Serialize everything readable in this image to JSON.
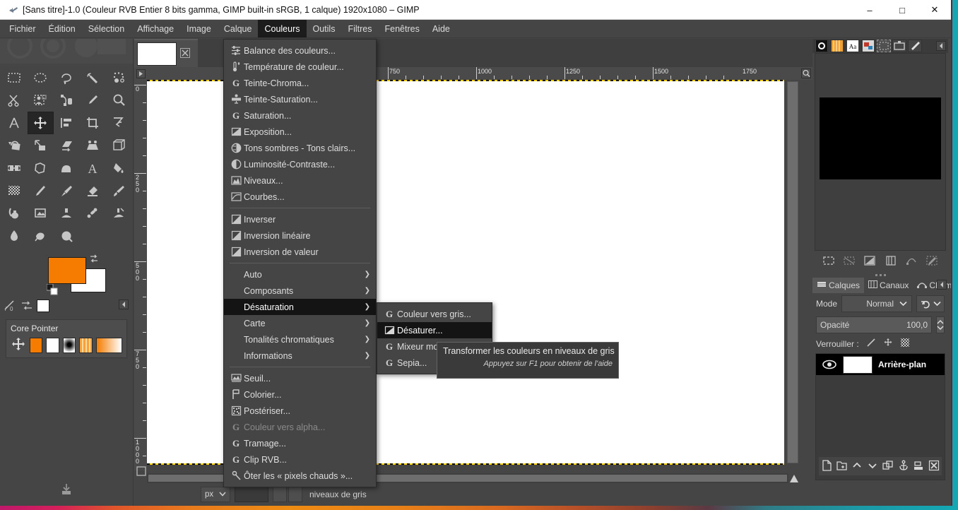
{
  "window": {
    "title": "[Sans titre]-1.0 (Couleur RVB Entier 8 bits gamma, GIMP built-in sRGB, 1 calque) 1920x1080 – GIMP",
    "app_icon": "gimp-wilber-icon",
    "controls": {
      "minimize": "–",
      "maximize": "□",
      "close": "✕"
    }
  },
  "menubar": {
    "items": [
      {
        "label": "Fichier"
      },
      {
        "label": "Édition"
      },
      {
        "label": "Sélection"
      },
      {
        "label": "Affichage"
      },
      {
        "label": "Image"
      },
      {
        "label": "Calque"
      },
      {
        "label": "Couleurs"
      },
      {
        "label": "Outils"
      },
      {
        "label": "Filtres"
      },
      {
        "label": "Fenêtres"
      },
      {
        "label": "Aide"
      }
    ],
    "active": "Couleurs"
  },
  "colors_menu": {
    "groups": [
      {
        "items": [
          {
            "label": "Balance des couleurs...",
            "icon": "color-balance-icon",
            "type": "item"
          },
          {
            "label": "Température de couleur...",
            "icon": "thermometer-icon",
            "type": "item"
          },
          {
            "label": "Teinte-Chroma...",
            "icon": "gegl-g-icon",
            "type": "item"
          },
          {
            "label": "Teinte-Saturation...",
            "icon": "hue-saturation-icon",
            "type": "item"
          },
          {
            "label": "Saturation...",
            "icon": "gegl-g-icon",
            "type": "item"
          },
          {
            "label": "Exposition...",
            "icon": "exposure-icon",
            "type": "item"
          },
          {
            "label": "Tons sombres - Tons clairs...",
            "icon": "shadows-highlights-icon",
            "type": "item"
          },
          {
            "label": "Luminosité-Contraste...",
            "icon": "brightness-contrast-icon",
            "type": "item"
          },
          {
            "label": "Niveaux...",
            "icon": "levels-icon",
            "type": "item"
          },
          {
            "label": "Courbes...",
            "icon": "curves-icon",
            "type": "item"
          }
        ]
      },
      {
        "items": [
          {
            "label": "Inverser",
            "icon": "invert-icon",
            "type": "item"
          },
          {
            "label": "Inversion linéaire",
            "icon": "invert-icon",
            "type": "item"
          },
          {
            "label": "Inversion de valeur",
            "icon": "invert-icon",
            "type": "item"
          }
        ]
      },
      {
        "items": [
          {
            "label": "Auto",
            "icon": "",
            "type": "submenu"
          },
          {
            "label": "Composants",
            "icon": "",
            "type": "submenu"
          },
          {
            "label": "Désaturation",
            "icon": "",
            "type": "submenu",
            "highlighted": true
          },
          {
            "label": "Carte",
            "icon": "",
            "type": "submenu"
          },
          {
            "label": "Tonalités chromatiques",
            "icon": "",
            "type": "submenu"
          },
          {
            "label": "Informations",
            "icon": "",
            "type": "submenu"
          }
        ]
      },
      {
        "items": [
          {
            "label": "Seuil...",
            "icon": "threshold-icon",
            "type": "item"
          },
          {
            "label": "Colorier...",
            "icon": "colorize-icon",
            "type": "item"
          },
          {
            "label": "Postériser...",
            "icon": "posterize-icon",
            "type": "item"
          },
          {
            "label": "Couleur vers alpha...",
            "icon": "gegl-g-icon",
            "type": "item",
            "disabled": true
          },
          {
            "label": "Tramage...",
            "icon": "gegl-g-icon",
            "type": "item"
          },
          {
            "label": "Clip RVB...",
            "icon": "gegl-g-icon",
            "type": "item"
          },
          {
            "label": "Ôter les « pixels chauds »...",
            "icon": "hot-pixels-icon",
            "type": "item"
          }
        ]
      }
    ]
  },
  "desaturation_submenu": {
    "items": [
      {
        "label": "Couleur vers gris...",
        "icon": "gegl-g-icon"
      },
      {
        "label": "Désaturer...",
        "icon": "desaturate-icon",
        "highlighted": true
      },
      {
        "label": "Mixeur monochrome...",
        "icon": "gegl-g-icon"
      },
      {
        "label": "Sepia...",
        "icon": "gegl-g-icon"
      }
    ]
  },
  "tooltip": {
    "text": "Transformer les couleurs en niveaux de gris",
    "hint": "Appuyez sur F1 pour obtenir de l'aide"
  },
  "toolbox": {
    "tools": [
      {
        "name": "rect-select-tool"
      },
      {
        "name": "ellipse-select-tool"
      },
      {
        "name": "free-select-tool"
      },
      {
        "name": "fuzzy-select-tool"
      },
      {
        "name": "select-by-color-tool"
      },
      {
        "name": "scissors-select-tool"
      },
      {
        "name": "foreground-select-tool"
      },
      {
        "name": "paths-tool"
      },
      {
        "name": "color-picker-tool"
      },
      {
        "name": "zoom-tool"
      },
      {
        "name": "measure-tool"
      },
      {
        "name": "move-tool"
      },
      {
        "name": "alignment-tool"
      },
      {
        "name": "crop-tool"
      },
      {
        "name": "transform-tool"
      },
      {
        "name": "rotate-tool"
      },
      {
        "name": "scale-tool"
      },
      {
        "name": "shear-tool"
      },
      {
        "name": "perspective-tool"
      },
      {
        "name": "3d-transform-tool"
      },
      {
        "name": "flip-tool"
      },
      {
        "name": "cage-transform-tool"
      },
      {
        "name": "warp-transform-tool"
      },
      {
        "name": "text-tool"
      },
      {
        "name": "bucket-fill-tool"
      },
      {
        "name": "gradient-tool"
      },
      {
        "name": "pencil-tool"
      },
      {
        "name": "paintbrush-tool"
      },
      {
        "name": "eraser-tool"
      },
      {
        "name": "ink-tool"
      },
      {
        "name": "mypaint-brush-tool"
      },
      {
        "name": "clone-tool"
      },
      {
        "name": "heal-tool"
      },
      {
        "name": "perspective-clone-tool"
      },
      {
        "name": "blur-sharpen-tool"
      },
      {
        "name": "smudge-tool"
      },
      {
        "name": "dodge-burn-tool"
      }
    ],
    "selected_tool": "move-tool",
    "foreground_color": "#f57c00",
    "background_color": "#ffffff",
    "device_status": {
      "title": "Core Pointer",
      "device_icon": "move-tool",
      "fg_swatch": "#f57c00",
      "bg_swatch": "#ffffff",
      "brush": "brush-hardness-050",
      "pattern": "pattern-stripes",
      "gradient": "gradient-fg-to-bg"
    }
  },
  "image_window": {
    "tab_thumbnail": "image-thumbnail",
    "close_tab_icon": "close-icon",
    "rulers": {
      "horizontal_labels": [
        "750",
        "1000",
        "1250",
        "1500",
        "1750"
      ],
      "vertical_labels": [
        "0",
        "250",
        "500",
        "750",
        "1000"
      ],
      "unit": "px"
    },
    "statusbar": {
      "unit": "px",
      "message": "niveaux de gris",
      "quickmask_icon": "quickmask-icon",
      "navigate_icon": "navigate-icon"
    }
  },
  "right_dock": {
    "upper_tabs": [
      {
        "name": "brushes-tab"
      },
      {
        "name": "patterns-tab"
      },
      {
        "name": "fonts-tab"
      },
      {
        "name": "document-history-tab"
      },
      {
        "name": "selection-editor-tab"
      },
      {
        "name": "undo-history-tab"
      },
      {
        "name": "pointer-tab"
      }
    ],
    "upper_selected": "selection-editor-tab",
    "selection_buttons": [
      {
        "name": "select-all-button"
      },
      {
        "name": "select-none-button"
      },
      {
        "name": "invert-selection-button"
      },
      {
        "name": "save-to-channel-button"
      },
      {
        "name": "to-path-button"
      },
      {
        "name": "stroke-selection-button"
      }
    ],
    "layers_tabs": [
      {
        "label": "Calques",
        "icon": "layers-icon",
        "selected": true
      },
      {
        "label": "Canaux",
        "icon": "channels-icon",
        "selected": false
      },
      {
        "label": "Chemins",
        "icon": "paths-icon",
        "selected": false
      }
    ],
    "mode": {
      "label": "Mode",
      "value": "Normal",
      "reset_icon": "reset-icon"
    },
    "opacity": {
      "label": "Opacité",
      "value": "100,0"
    },
    "lock": {
      "label": "Verrouiller :",
      "items": [
        {
          "name": "lock-pixels-icon"
        },
        {
          "name": "lock-position-icon"
        },
        {
          "name": "lock-alpha-icon"
        }
      ]
    },
    "layers": [
      {
        "name": "Arrière-plan",
        "visible": true,
        "thumbnail_color": "#ffffff"
      }
    ],
    "layer_buttons": [
      {
        "name": "new-layer-button"
      },
      {
        "name": "new-layer-group-button"
      },
      {
        "name": "raise-layer-button"
      },
      {
        "name": "lower-layer-button"
      },
      {
        "name": "duplicate-layer-button"
      },
      {
        "name": "anchor-layer-button"
      },
      {
        "name": "merge-down-button"
      },
      {
        "name": "delete-layer-button"
      }
    ]
  },
  "colors": {
    "window_bg": "#454545",
    "menu_bg": "#454545",
    "menu_highlight": "#141414",
    "accent_orange": "#f57c00",
    "tooltip_bg": "#3a3a3a",
    "canvas_white": "#ffffff"
  }
}
